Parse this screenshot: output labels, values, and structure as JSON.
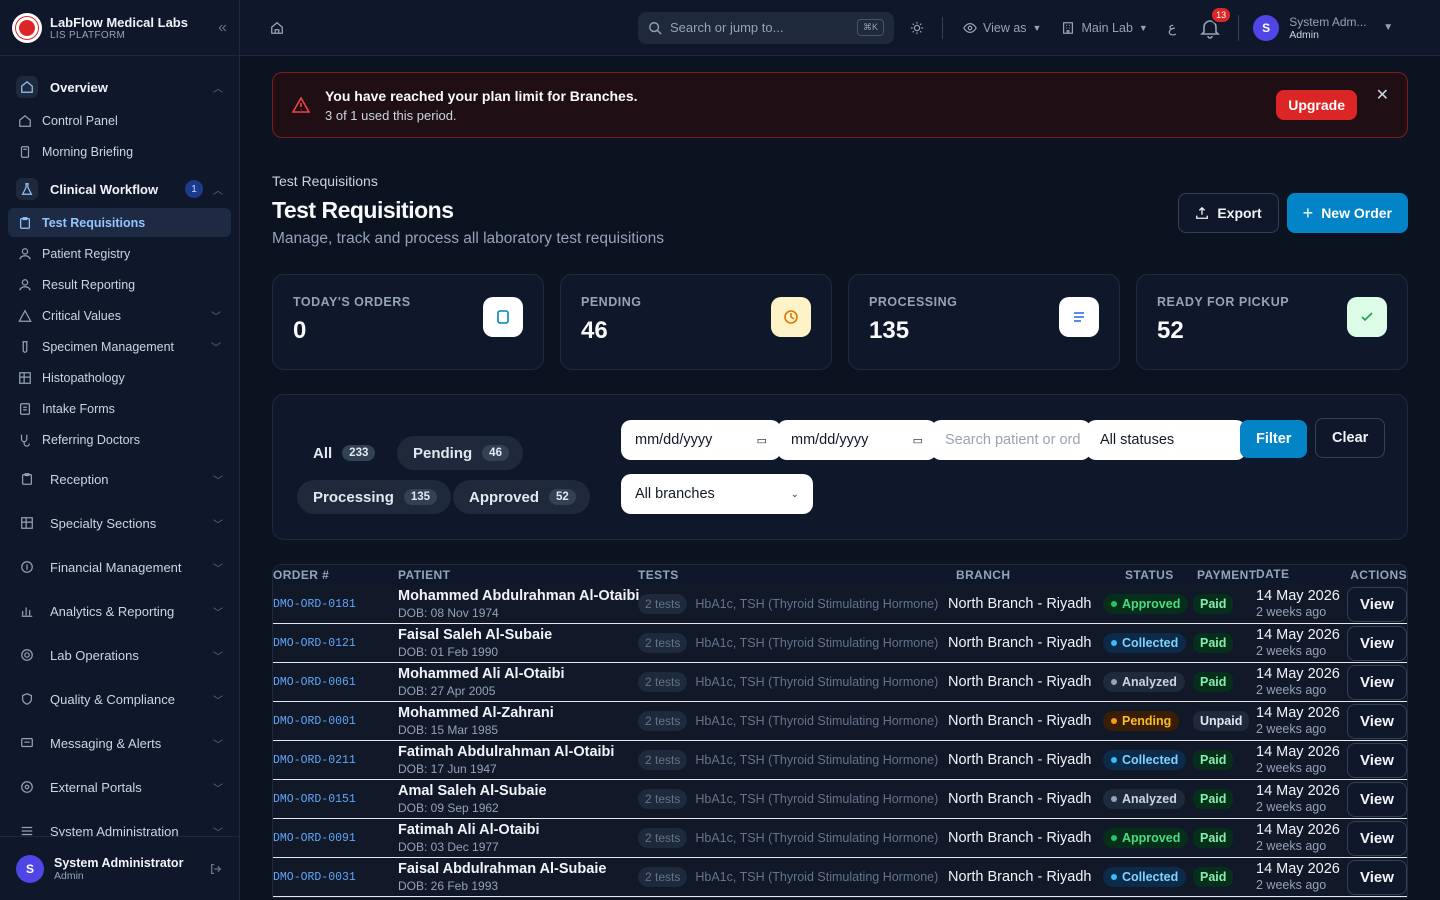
{
  "app": {
    "name": "LabFlow Medical Labs",
    "subtitle": "LIS PLATFORM"
  },
  "sidebar": {
    "groups": [
      {
        "label": "Overview",
        "expanded": true,
        "items": [
          "Control Panel",
          "Morning Briefing"
        ]
      },
      {
        "label": "Clinical Workflow",
        "expanded": true,
        "badge": "1",
        "items": [
          "Test Requisitions",
          "Patient Registry",
          "Result Reporting",
          "Critical Values",
          "Specimen Management",
          "Histopathology",
          "Intake Forms",
          "Referring Doctors"
        ]
      },
      {
        "label": "Reception"
      },
      {
        "label": "Specialty Sections"
      },
      {
        "label": "Financial Management"
      },
      {
        "label": "Analytics & Reporting"
      },
      {
        "label": "Lab Operations"
      },
      {
        "label": "Quality & Compliance"
      },
      {
        "label": "Messaging & Alerts"
      },
      {
        "label": "External Portals"
      },
      {
        "label": "System Administration"
      }
    ],
    "active_item": "Test Requisitions",
    "user": {
      "initial": "S",
      "name": "System Administrator",
      "role": "Admin"
    }
  },
  "topbar": {
    "search_placeholder": "Search or jump to...",
    "search_shortcut": "⌘K",
    "view_as": "View as",
    "lab": "Main Lab",
    "lang": "ع",
    "notifications": "13",
    "user_name": "System Adm...",
    "user_role": "Admin",
    "user_initial": "S"
  },
  "alert": {
    "title": "You have reached your plan limit for Branches.",
    "subtitle": "3 of 1 used this period.",
    "button": "Upgrade"
  },
  "page": {
    "breadcrumb": "Test Requisitions",
    "title": "Test Requisitions",
    "description": "Manage, track and process all laboratory test requisitions",
    "export_label": "Export",
    "new_order_label": "New Order"
  },
  "stats": [
    {
      "label": "TODAY'S ORDERS",
      "value": "0",
      "icon": "clipboard-icon",
      "color": "#0284c7"
    },
    {
      "label": "PENDING",
      "value": "46",
      "icon": "clock-icon",
      "color": "#d97706"
    },
    {
      "label": "PROCESSING",
      "value": "135",
      "icon": "list-icon",
      "color": "#2563eb"
    },
    {
      "label": "READY FOR PICKUP",
      "value": "52",
      "icon": "check-icon",
      "color": "#16a34a"
    }
  ],
  "filters": {
    "chips": [
      {
        "label": "All",
        "count": "233"
      },
      {
        "label": "Pending",
        "count": "46"
      },
      {
        "label": "Processing",
        "count": "135"
      },
      {
        "label": "Approved",
        "count": "52"
      }
    ],
    "date_from": "mm/dd/yyyy",
    "date_to": "mm/dd/yyyy",
    "search_placeholder": "Search patient or ord",
    "status_value": "All statuses",
    "branch_value": "All branches",
    "filter_label": "Filter",
    "clear_label": "Clear"
  },
  "table": {
    "headers": [
      "ORDER #",
      "PATIENT",
      "TESTS",
      "BRANCH",
      "STATUS",
      "PAYMENT",
      "DATE",
      "ACTIONS"
    ],
    "rows": [
      {
        "order": "DMO-ORD-0181",
        "patient": "Mohammed Abdulrahman Al-Otaibi",
        "dob": "DOB: 08 Nov 1974",
        "tests_count": "2 tests",
        "tests": "HbA1c, TSH (Thyroid Stimulating Hormone)",
        "branch": "North Branch - Riyadh",
        "status": "Approved",
        "payment": "Paid",
        "date": "14 May 2026",
        "relative": "2 weeks ago",
        "action": "View"
      },
      {
        "order": "DMO-ORD-0121",
        "patient": "Faisal Saleh Al-Subaie",
        "dob": "DOB: 01 Feb 1990",
        "tests_count": "2 tests",
        "tests": "HbA1c, TSH (Thyroid Stimulating Hormone)",
        "branch": "North Branch - Riyadh",
        "status": "Collected",
        "payment": "Paid",
        "date": "14 May 2026",
        "relative": "2 weeks ago",
        "action": "View"
      },
      {
        "order": "DMO-ORD-0061",
        "patient": "Mohammed Ali Al-Otaibi",
        "dob": "DOB: 27 Apr 2005",
        "tests_count": "2 tests",
        "tests": "HbA1c, TSH (Thyroid Stimulating Hormone)",
        "branch": "North Branch - Riyadh",
        "status": "Analyzed",
        "payment": "Paid",
        "date": "14 May 2026",
        "relative": "2 weeks ago",
        "action": "View"
      },
      {
        "order": "DMO-ORD-0001",
        "patient": "Mohammed Al-Zahrani",
        "dob": "DOB: 15 Mar 1985",
        "tests_count": "2 tests",
        "tests": "HbA1c, TSH (Thyroid Stimulating Hormone)",
        "branch": "North Branch - Riyadh",
        "status": "Pending",
        "payment": "Unpaid",
        "date": "14 May 2026",
        "relative": "2 weeks ago",
        "action": "View"
      },
      {
        "order": "DMO-ORD-0211",
        "patient": "Fatimah Abdulrahman Al-Otaibi",
        "dob": "DOB: 17 Jun 1947",
        "tests_count": "2 tests",
        "tests": "HbA1c, TSH (Thyroid Stimulating Hormone)",
        "branch": "North Branch - Riyadh",
        "status": "Collected",
        "payment": "Paid",
        "date": "14 May 2026",
        "relative": "2 weeks ago",
        "action": "View"
      },
      {
        "order": "DMO-ORD-0151",
        "patient": "Amal Saleh Al-Subaie",
        "dob": "DOB: 09 Sep 1962",
        "tests_count": "2 tests",
        "tests": "HbA1c, TSH (Thyroid Stimulating Hormone)",
        "branch": "North Branch - Riyadh",
        "status": "Analyzed",
        "payment": "Paid",
        "date": "14 May 2026",
        "relative": "2 weeks ago",
        "action": "View"
      },
      {
        "order": "DMO-ORD-0091",
        "patient": "Fatimah Ali Al-Otaibi",
        "dob": "DOB: 03 Dec 1977",
        "tests_count": "2 tests",
        "tests": "HbA1c, TSH (Thyroid Stimulating Hormone)",
        "branch": "North Branch - Riyadh",
        "status": "Approved",
        "payment": "Paid",
        "date": "14 May 2026",
        "relative": "2 weeks ago",
        "action": "View"
      },
      {
        "order": "DMO-ORD-0031",
        "patient": "Faisal Abdulrahman Al-Subaie",
        "dob": "DOB: 26 Feb 1993",
        "tests_count": "2 tests",
        "tests": "HbA1c, TSH (Thyroid Stimulating Hormone)",
        "branch": "North Branch - Riyadh",
        "status": "Collected",
        "payment": "Paid",
        "date": "14 May 2026",
        "relative": "2 weeks ago",
        "action": "View"
      }
    ]
  },
  "status_colors": {
    "Approved": {
      "bg": "#052e1b",
      "fg": "#4ade80",
      "dot": "#22c55e"
    },
    "Collected": {
      "bg": "#0c2a4a",
      "fg": "#7dd3fc",
      "dot": "#38bdf8"
    },
    "Analyzed": {
      "bg": "#1e293b",
      "fg": "#cbd5e1",
      "dot": "#94a3b8"
    },
    "Pending": {
      "bg": "#3a1d05",
      "fg": "#fbbf24",
      "dot": "#f59e0b"
    }
  },
  "payment_colors": {
    "Paid": {
      "bg": "#052e1b",
      "fg": "#86efac"
    },
    "Unpaid": {
      "bg": "#1e293b",
      "fg": "#e2e8f0"
    }
  }
}
